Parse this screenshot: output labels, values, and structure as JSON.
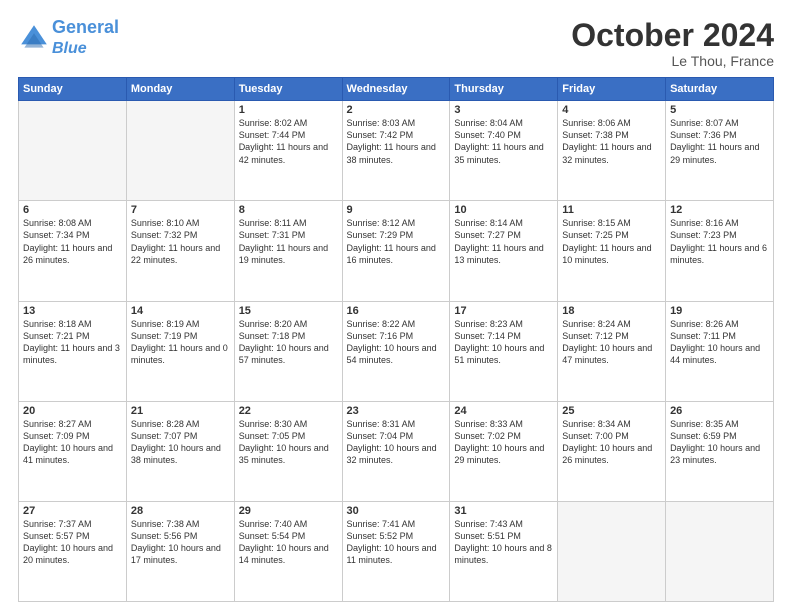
{
  "header": {
    "logo_line1": "General",
    "logo_line2": "Blue",
    "month": "October 2024",
    "location": "Le Thou, France"
  },
  "weekdays": [
    "Sunday",
    "Monday",
    "Tuesday",
    "Wednesday",
    "Thursday",
    "Friday",
    "Saturday"
  ],
  "weeks": [
    [
      {
        "day": "",
        "info": ""
      },
      {
        "day": "",
        "info": ""
      },
      {
        "day": "1",
        "info": "Sunrise: 8:02 AM\nSunset: 7:44 PM\nDaylight: 11 hours and 42 minutes."
      },
      {
        "day": "2",
        "info": "Sunrise: 8:03 AM\nSunset: 7:42 PM\nDaylight: 11 hours and 38 minutes."
      },
      {
        "day": "3",
        "info": "Sunrise: 8:04 AM\nSunset: 7:40 PM\nDaylight: 11 hours and 35 minutes."
      },
      {
        "day": "4",
        "info": "Sunrise: 8:06 AM\nSunset: 7:38 PM\nDaylight: 11 hours and 32 minutes."
      },
      {
        "day": "5",
        "info": "Sunrise: 8:07 AM\nSunset: 7:36 PM\nDaylight: 11 hours and 29 minutes."
      }
    ],
    [
      {
        "day": "6",
        "info": "Sunrise: 8:08 AM\nSunset: 7:34 PM\nDaylight: 11 hours and 26 minutes."
      },
      {
        "day": "7",
        "info": "Sunrise: 8:10 AM\nSunset: 7:32 PM\nDaylight: 11 hours and 22 minutes."
      },
      {
        "day": "8",
        "info": "Sunrise: 8:11 AM\nSunset: 7:31 PM\nDaylight: 11 hours and 19 minutes."
      },
      {
        "day": "9",
        "info": "Sunrise: 8:12 AM\nSunset: 7:29 PM\nDaylight: 11 hours and 16 minutes."
      },
      {
        "day": "10",
        "info": "Sunrise: 8:14 AM\nSunset: 7:27 PM\nDaylight: 11 hours and 13 minutes."
      },
      {
        "day": "11",
        "info": "Sunrise: 8:15 AM\nSunset: 7:25 PM\nDaylight: 11 hours and 10 minutes."
      },
      {
        "day": "12",
        "info": "Sunrise: 8:16 AM\nSunset: 7:23 PM\nDaylight: 11 hours and 6 minutes."
      }
    ],
    [
      {
        "day": "13",
        "info": "Sunrise: 8:18 AM\nSunset: 7:21 PM\nDaylight: 11 hours and 3 minutes."
      },
      {
        "day": "14",
        "info": "Sunrise: 8:19 AM\nSunset: 7:19 PM\nDaylight: 11 hours and 0 minutes."
      },
      {
        "day": "15",
        "info": "Sunrise: 8:20 AM\nSunset: 7:18 PM\nDaylight: 10 hours and 57 minutes."
      },
      {
        "day": "16",
        "info": "Sunrise: 8:22 AM\nSunset: 7:16 PM\nDaylight: 10 hours and 54 minutes."
      },
      {
        "day": "17",
        "info": "Sunrise: 8:23 AM\nSunset: 7:14 PM\nDaylight: 10 hours and 51 minutes."
      },
      {
        "day": "18",
        "info": "Sunrise: 8:24 AM\nSunset: 7:12 PM\nDaylight: 10 hours and 47 minutes."
      },
      {
        "day": "19",
        "info": "Sunrise: 8:26 AM\nSunset: 7:11 PM\nDaylight: 10 hours and 44 minutes."
      }
    ],
    [
      {
        "day": "20",
        "info": "Sunrise: 8:27 AM\nSunset: 7:09 PM\nDaylight: 10 hours and 41 minutes."
      },
      {
        "day": "21",
        "info": "Sunrise: 8:28 AM\nSunset: 7:07 PM\nDaylight: 10 hours and 38 minutes."
      },
      {
        "day": "22",
        "info": "Sunrise: 8:30 AM\nSunset: 7:05 PM\nDaylight: 10 hours and 35 minutes."
      },
      {
        "day": "23",
        "info": "Sunrise: 8:31 AM\nSunset: 7:04 PM\nDaylight: 10 hours and 32 minutes."
      },
      {
        "day": "24",
        "info": "Sunrise: 8:33 AM\nSunset: 7:02 PM\nDaylight: 10 hours and 29 minutes."
      },
      {
        "day": "25",
        "info": "Sunrise: 8:34 AM\nSunset: 7:00 PM\nDaylight: 10 hours and 26 minutes."
      },
      {
        "day": "26",
        "info": "Sunrise: 8:35 AM\nSunset: 6:59 PM\nDaylight: 10 hours and 23 minutes."
      }
    ],
    [
      {
        "day": "27",
        "info": "Sunrise: 7:37 AM\nSunset: 5:57 PM\nDaylight: 10 hours and 20 minutes."
      },
      {
        "day": "28",
        "info": "Sunrise: 7:38 AM\nSunset: 5:56 PM\nDaylight: 10 hours and 17 minutes."
      },
      {
        "day": "29",
        "info": "Sunrise: 7:40 AM\nSunset: 5:54 PM\nDaylight: 10 hours and 14 minutes."
      },
      {
        "day": "30",
        "info": "Sunrise: 7:41 AM\nSunset: 5:52 PM\nDaylight: 10 hours and 11 minutes."
      },
      {
        "day": "31",
        "info": "Sunrise: 7:43 AM\nSunset: 5:51 PM\nDaylight: 10 hours and 8 minutes."
      },
      {
        "day": "",
        "info": ""
      },
      {
        "day": "",
        "info": ""
      }
    ]
  ]
}
